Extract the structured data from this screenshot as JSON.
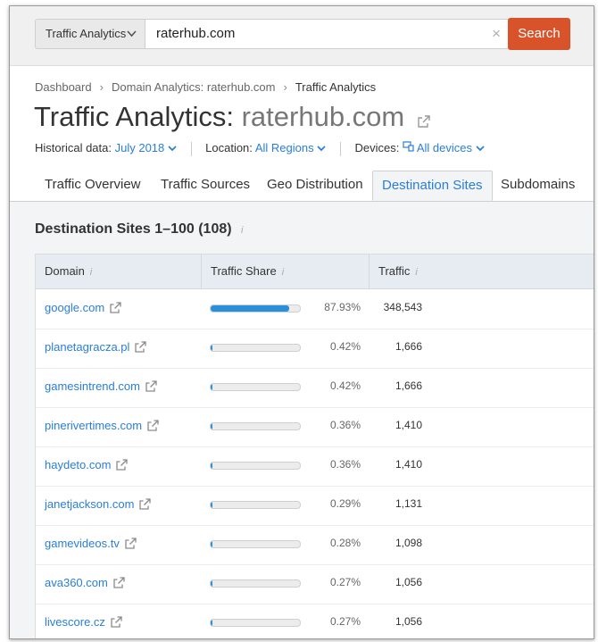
{
  "search": {
    "database_label": "Traffic Analytics",
    "query": "raterhub.com",
    "button_label": "Search"
  },
  "breadcrumb": [
    "Dashboard",
    "Domain Analytics: raterhub.com",
    "Traffic Analytics"
  ],
  "title": {
    "prefix": "Traffic Analytics:",
    "domain": "raterhub.com"
  },
  "filters": {
    "historical_label": "Historical data:",
    "historical_value": "July 2018",
    "location_label": "Location:",
    "location_value": "All Regions",
    "devices_label": "Devices:",
    "devices_value": "All devices"
  },
  "tabs": [
    "Traffic Overview",
    "Traffic Sources",
    "Geo Distribution",
    "Destination Sites",
    "Subdomains"
  ],
  "active_tab": "Destination Sites",
  "section": {
    "title": "Destination Sites",
    "range": "1–100",
    "total": "(108)"
  },
  "table": {
    "columns": [
      "Domain",
      "Traffic Share",
      "Traffic"
    ],
    "rows": [
      {
        "domain": "google.com",
        "share": "87.93%",
        "share_value": 87.93,
        "traffic": "348,543"
      },
      {
        "domain": "planetagracza.pl",
        "share": "0.42%",
        "share_value": 0.42,
        "traffic": "1,666"
      },
      {
        "domain": "gamesintrend.com",
        "share": "0.42%",
        "share_value": 0.42,
        "traffic": "1,666"
      },
      {
        "domain": "pinerivertimes.com",
        "share": "0.36%",
        "share_value": 0.36,
        "traffic": "1,410"
      },
      {
        "domain": "haydeto.com",
        "share": "0.36%",
        "share_value": 0.36,
        "traffic": "1,410"
      },
      {
        "domain": "janetjackson.com",
        "share": "0.29%",
        "share_value": 0.29,
        "traffic": "1,131"
      },
      {
        "domain": "gamevideos.tv",
        "share": "0.28%",
        "share_value": 0.28,
        "traffic": "1,098"
      },
      {
        "domain": "ava360.com",
        "share": "0.27%",
        "share_value": 0.27,
        "traffic": "1,056"
      },
      {
        "domain": "livescore.cz",
        "share": "0.27%",
        "share_value": 0.27,
        "traffic": "1,056"
      }
    ]
  },
  "colors": {
    "accent": "#2a7ed8",
    "search_button": "#d8532a",
    "bar_fill": "#2a8fd8"
  },
  "icons": {
    "external_link": "external-link-icon",
    "chevron": "chevron-down-icon",
    "info": "info-icon",
    "devices": "devices-icon",
    "clear": "close-icon"
  }
}
